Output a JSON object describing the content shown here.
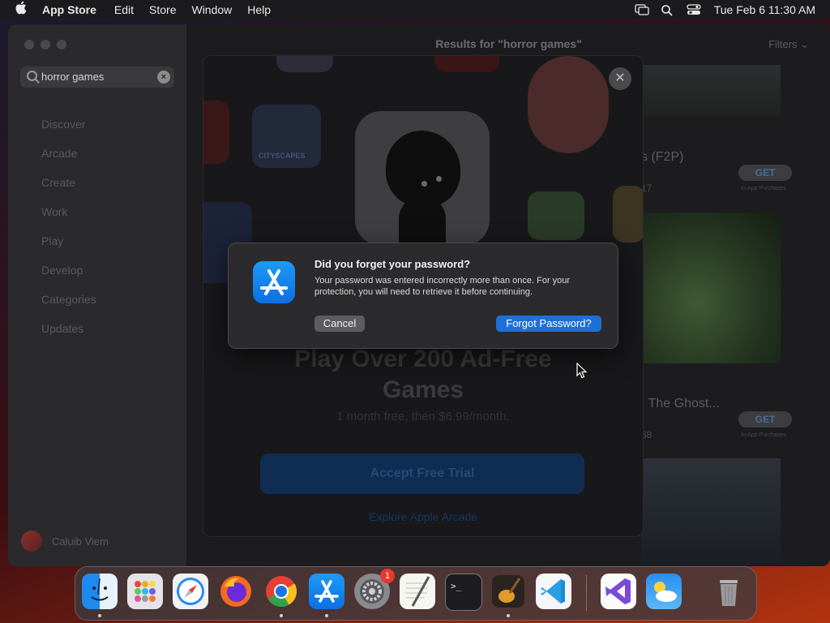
{
  "menubar": {
    "app_name": "App Store",
    "menus": [
      "Edit",
      "Store",
      "Window",
      "Help"
    ],
    "clock": "Tue Feb 6  11:30 AM"
  },
  "sidebar": {
    "search": {
      "value": "horror games",
      "clear_glyph": "×"
    },
    "items": [
      {
        "label": "Discover"
      },
      {
        "label": "Arcade"
      },
      {
        "label": "Create"
      },
      {
        "label": "Work"
      },
      {
        "label": "Play"
      },
      {
        "label": "Develop"
      },
      {
        "label": "Categories"
      },
      {
        "label": "Updates"
      }
    ],
    "user_name": "Caluib Viem"
  },
  "main": {
    "results_title": "Results for \"horror games\"",
    "filters_label": "Filters",
    "results": [
      {
        "title_partial": "s (F2P)",
        "meta_partial": "17",
        "get_label": "GET",
        "iap_note": "In-App Purchases"
      },
      {
        "title_partial": ": The Ghost...",
        "meta_partial": "68",
        "get_label": "GET",
        "iap_note": "In-App Purchases"
      }
    ]
  },
  "arcade_sheet": {
    "close_glyph": "✕",
    "promo_title_line1": "Play Over 200 Ad-Free",
    "promo_title_line2": "Games",
    "promo_subtitle": "1 month free, then $6.99/month.",
    "trial_button": "Accept Free Trial",
    "explore_link": "Explore Apple Arcade",
    "tile_label": "CITYSCAPES"
  },
  "alert": {
    "title": "Did you forget your password?",
    "body": "Your password was entered incorrectly more than once. For your protection, you will need to retrieve it before continuing.",
    "cancel_label": "Cancel",
    "forgot_label": "Forgot Password?"
  },
  "dock": {
    "apps": [
      "finder-icon",
      "launchpad-icon",
      "safari-icon",
      "firefox-icon",
      "chrome-icon",
      "app-store-icon",
      "system-settings-icon",
      "textedit-icon",
      "terminal-icon",
      "garageband-icon",
      "vscode-icon",
      "visual-studio-icon",
      "weather-icon",
      "trash-icon"
    ],
    "settings_badge": "1"
  },
  "colors": {
    "accent": "#1f6fd8",
    "app_store_blue": "#0d6fe2",
    "badge_red": "#e33a2f"
  }
}
